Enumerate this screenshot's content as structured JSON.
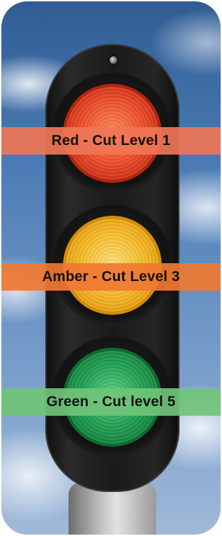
{
  "lights": [
    {
      "color": "red",
      "label": "Red - Cut Level 1",
      "band_color": "#f07656"
    },
    {
      "color": "amber",
      "label": "Amber - Cut Level 3",
      "band_color": "#f07832"
    },
    {
      "color": "green",
      "label": "Green - Cut level 5",
      "band_color": "#70c478"
    }
  ]
}
